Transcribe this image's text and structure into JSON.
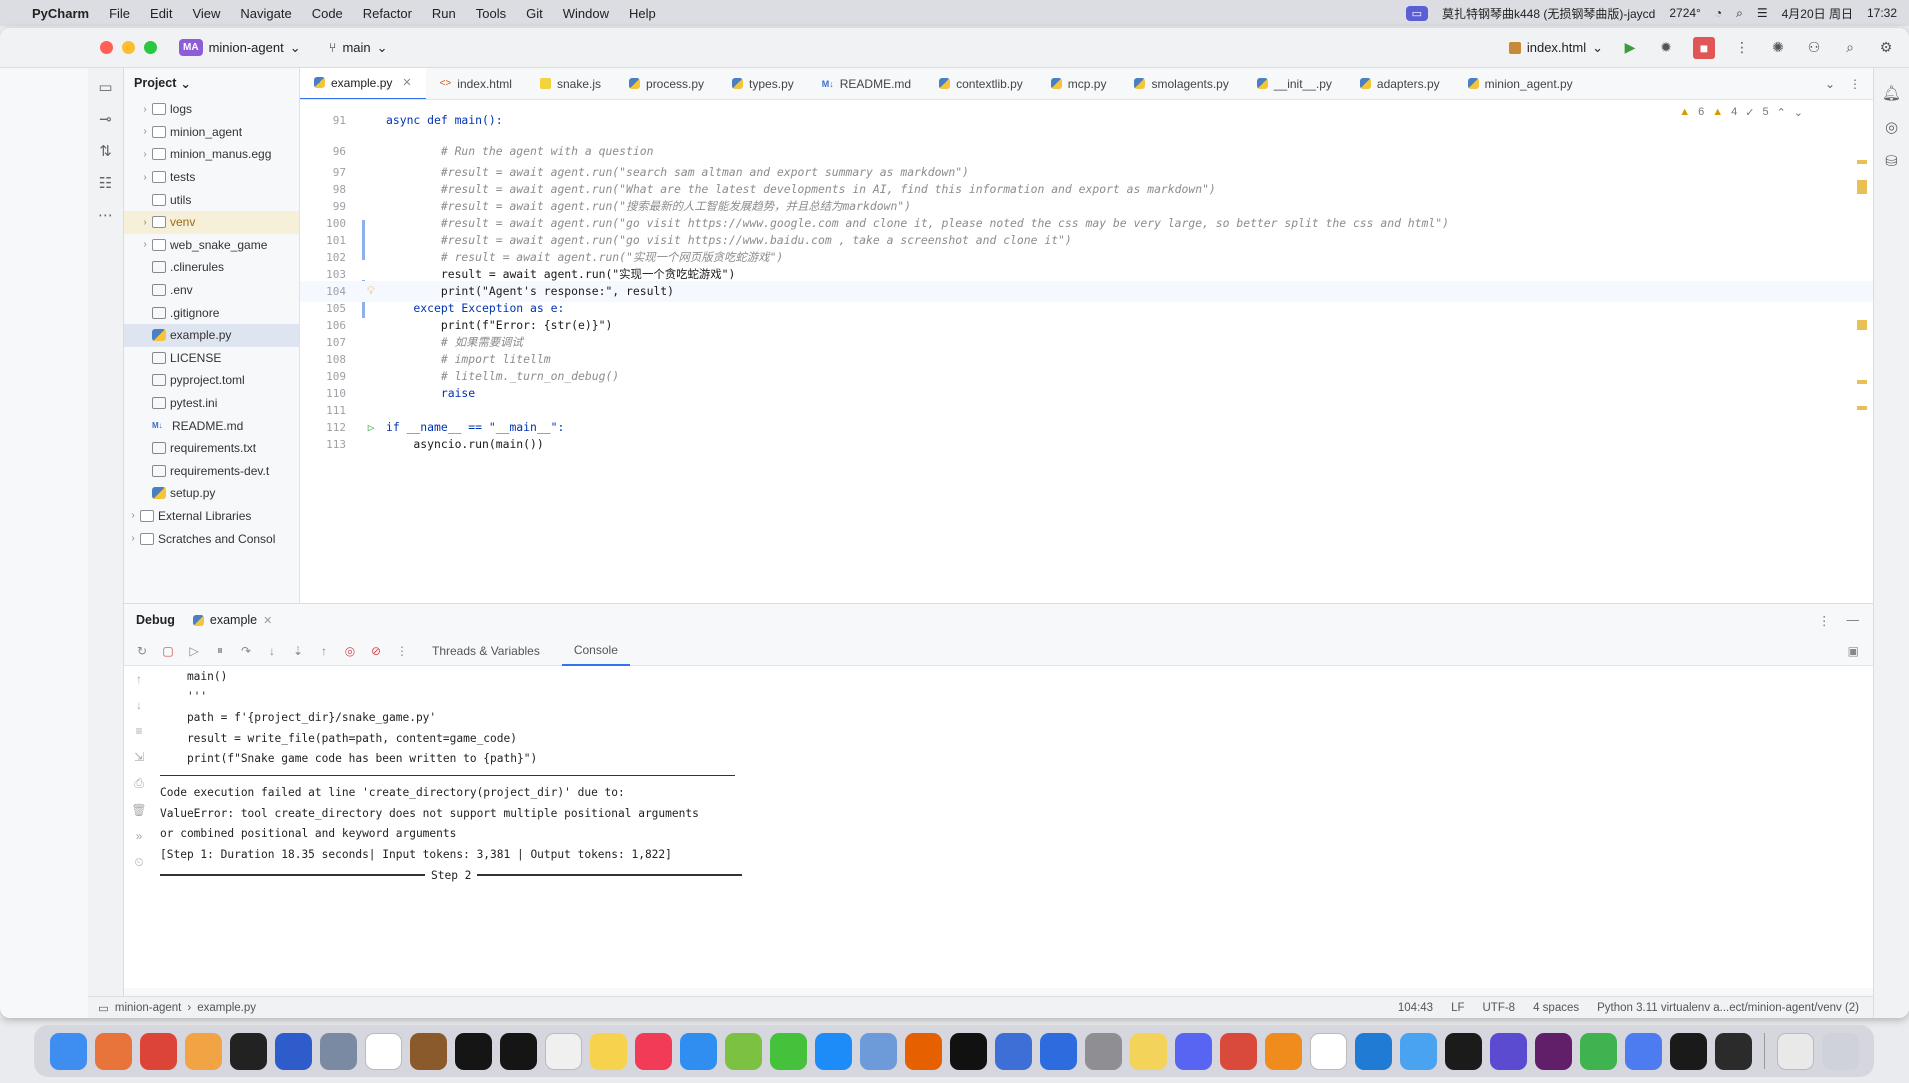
{
  "menubar": {
    "app": "PyCharm",
    "items": [
      "File",
      "Edit",
      "View",
      "Navigate",
      "Code",
      "Refactor",
      "Run",
      "Tools",
      "Git",
      "Window",
      "Help"
    ],
    "now_playing": "莫扎特钢琴曲k448 (无损钢琴曲版)-jaycd",
    "temp": "2724",
    "date": "4月20日 周日",
    "time": "17:32"
  },
  "titlebar": {
    "project_badge": "MA",
    "project_name": "minion-agent",
    "branch": "main",
    "run_config": "index.html"
  },
  "project_panel": {
    "title": "Project",
    "items": [
      {
        "label": "logs",
        "type": "folder",
        "expandable": true
      },
      {
        "label": "minion_agent",
        "type": "folder",
        "expandable": true
      },
      {
        "label": "minion_manus.egg",
        "type": "folder",
        "expandable": true
      },
      {
        "label": "tests",
        "type": "folder",
        "expandable": true
      },
      {
        "label": "utils",
        "type": "folder",
        "expandable": false
      },
      {
        "label": "venv",
        "type": "folder",
        "expandable": true,
        "highlight": "venv"
      },
      {
        "label": "web_snake_game",
        "type": "folder",
        "expandable": true
      },
      {
        "label": ".clinerules",
        "type": "txt",
        "expandable": false
      },
      {
        "label": ".env",
        "type": "txt",
        "expandable": false
      },
      {
        "label": ".gitignore",
        "type": "txt",
        "expandable": false
      },
      {
        "label": "example.py",
        "type": "py",
        "expandable": false,
        "highlight": "selected"
      },
      {
        "label": "LICENSE",
        "type": "txt",
        "expandable": false
      },
      {
        "label": "pyproject.toml",
        "type": "txt",
        "expandable": false
      },
      {
        "label": "pytest.ini",
        "type": "txt",
        "expandable": false
      },
      {
        "label": "README.md",
        "type": "md",
        "expandable": false
      },
      {
        "label": "requirements.txt",
        "type": "txt",
        "expandable": false
      },
      {
        "label": "requirements-dev.t",
        "type": "txt",
        "expandable": false
      },
      {
        "label": "setup.py",
        "type": "py",
        "expandable": false
      },
      {
        "label": "External Libraries",
        "type": "lib",
        "expandable": true
      },
      {
        "label": "Scratches and Consol",
        "type": "lib",
        "expandable": true
      }
    ]
  },
  "tabs": [
    {
      "label": "example.py",
      "kind": "py",
      "active": true
    },
    {
      "label": "index.html",
      "kind": "html",
      "active": false
    },
    {
      "label": "snake.js",
      "kind": "js",
      "active": false
    },
    {
      "label": "process.py",
      "kind": "py",
      "active": false
    },
    {
      "label": "types.py",
      "kind": "py",
      "active": false
    },
    {
      "label": "README.md",
      "kind": "md",
      "active": false
    },
    {
      "label": "contextlib.py",
      "kind": "py",
      "active": false
    },
    {
      "label": "mcp.py",
      "kind": "py",
      "active": false
    },
    {
      "label": "smolagents.py",
      "kind": "py",
      "active": false
    },
    {
      "label": "__init__.py",
      "kind": "py",
      "active": false
    },
    {
      "label": "adapters.py",
      "kind": "py",
      "active": false
    },
    {
      "label": "minion_agent.py",
      "kind": "py",
      "active": false
    }
  ],
  "inspections": {
    "warnings": "6",
    "weak": "4",
    "typos": "5"
  },
  "code_lines": [
    {
      "n": "91",
      "text": "async def main():",
      "cls": "kw"
    },
    {
      "n": "96",
      "text": "        # Run the agent with a question",
      "cls": "cm"
    },
    {
      "n": "97",
      "text": "        #result = await agent.run(\"search sam altman and export summary as markdown\")",
      "cls": "cm"
    },
    {
      "n": "98",
      "text": "        #result = await agent.run(\"What are the latest developments in AI, find this information and export as markdown\")",
      "cls": "cm"
    },
    {
      "n": "99",
      "text": "        #result = await agent.run(\"搜索最新的人工智能发展趋势，并且总结为markdown\")",
      "cls": "cm"
    },
    {
      "n": "100",
      "text": "        #result = await agent.run(\"go visit https://www.google.com and clone it, please noted the css may be very large, so better split the css and html\")",
      "cls": "cm"
    },
    {
      "n": "101",
      "text": "        #result = await agent.run(\"go visit https://www.baidu.com , take a screenshot and clone it\")",
      "cls": "cm"
    },
    {
      "n": "102",
      "text": "        # result = await agent.run(\"实现一个网页版贪吃蛇游戏\")",
      "cls": "cm"
    },
    {
      "n": "103",
      "text": "        result = await agent.run(\"实现一个贪吃蛇游戏\")",
      "cls": "code"
    },
    {
      "n": "104",
      "text": "        print(\"Agent's response:\", result)",
      "cls": "code"
    },
    {
      "n": "105",
      "text": "    except Exception as e:",
      "cls": "kw"
    },
    {
      "n": "106",
      "text": "        print(f\"Error: {str(e)}\")",
      "cls": "code"
    },
    {
      "n": "107",
      "text": "        # 如果需要调试",
      "cls": "cm"
    },
    {
      "n": "108",
      "text": "        # import litellm",
      "cls": "cm"
    },
    {
      "n": "109",
      "text": "        # litellm._turn_on_debug()",
      "cls": "cm"
    },
    {
      "n": "110",
      "text": "        raise",
      "cls": "kw"
    },
    {
      "n": "111",
      "text": "",
      "cls": "code"
    },
    {
      "n": "112",
      "text": "if __name__ == \"__main__\":",
      "cls": "kw"
    },
    {
      "n": "113",
      "text": "    asyncio.run(main())",
      "cls": "code"
    }
  ],
  "debug": {
    "title": "Debug",
    "run_tab": "example",
    "subtabs": [
      "Threads & Variables",
      "Console"
    ],
    "active_subtab": "Console",
    "console_lines": [
      "    main()",
      "    '''",
      "    path = f'{project_dir}/snake_game.py'",
      "    result = write_file(path=path, content=game_code)",
      "    print(f\"Snake game code has been written to {path}\")"
    ],
    "error_lines": [
      "Code execution failed at line 'create_directory(project_dir)' due to:",
      "ValueError: tool create_directory does not support multiple positional arguments",
      "or combined positional and keyword arguments",
      "[Step 1: Duration 18.35 seconds| Input tokens: 3,381 | Output tokens: 1,822]"
    ],
    "step_label": "Step 2"
  },
  "statusbar": {
    "project": "minion-agent",
    "file": "example.py",
    "position": "104:43",
    "line_sep": "LF",
    "encoding": "UTF-8",
    "indent": "4 spaces",
    "interpreter": "Python 3.11 virtualenv a...ect/minion-agent/venv (2)"
  },
  "dock": [
    {
      "name": "finder",
      "color": "#3d8ef0"
    },
    {
      "name": "launchpad",
      "color": "#e8743b"
    },
    {
      "name": "chrome",
      "color": "#db4437"
    },
    {
      "name": "photos",
      "color": "#f2a444"
    },
    {
      "name": "terminal",
      "color": "#222222"
    },
    {
      "name": "screen-share",
      "color": "#2f5ccb"
    },
    {
      "name": "preview",
      "color": "#7b8aa3"
    },
    {
      "name": "calendar",
      "color": "#ffffff"
    },
    {
      "name": "app-brown",
      "color": "#8a5a2b"
    },
    {
      "name": "webstorm",
      "color": "#151515"
    },
    {
      "name": "rubymine",
      "color": "#151515"
    },
    {
      "name": "reminders",
      "color": "#f0f0f0"
    },
    {
      "name": "notes",
      "color": "#f7d24c"
    },
    {
      "name": "music",
      "color": "#f23b56"
    },
    {
      "name": "safari",
      "color": "#2f8ef0"
    },
    {
      "name": "app-green",
      "color": "#7cc142"
    },
    {
      "name": "wechat",
      "color": "#45c13b"
    },
    {
      "name": "app-store",
      "color": "#1d8cf8"
    },
    {
      "name": "app-circle",
      "color": "#6d9bd9"
    },
    {
      "name": "firefox",
      "color": "#e66000"
    },
    {
      "name": "pycharm",
      "color": "#111111"
    },
    {
      "name": "app-a",
      "color": "#3e6fd6"
    },
    {
      "name": "app-blue",
      "color": "#2d6cdf"
    },
    {
      "name": "settings",
      "color": "#8e8e93"
    },
    {
      "name": "app-yellow",
      "color": "#f3d35a"
    },
    {
      "name": "discord",
      "color": "#5865f2"
    },
    {
      "name": "app-star",
      "color": "#d94a3a"
    },
    {
      "name": "sublime",
      "color": "#f08b1e"
    },
    {
      "name": "notion",
      "color": "#ffffff"
    },
    {
      "name": "vscode",
      "color": "#1f7bd4"
    },
    {
      "name": "app-bird",
      "color": "#4aa3f0"
    },
    {
      "name": "activity",
      "color": "#1b1b1b"
    },
    {
      "name": "app-purple",
      "color": "#5a4bd1"
    },
    {
      "name": "slack",
      "color": "#611f69"
    },
    {
      "name": "numbers",
      "color": "#3fb34f"
    },
    {
      "name": "app-arrow",
      "color": "#4d7cf0"
    },
    {
      "name": "app-dark",
      "color": "#1a1a1a"
    },
    {
      "name": "openai",
      "color": "#2b2b2b"
    },
    {
      "name": "file",
      "color": "#e9e9ea"
    },
    {
      "name": "trash",
      "color": "#cfd2d8"
    }
  ]
}
